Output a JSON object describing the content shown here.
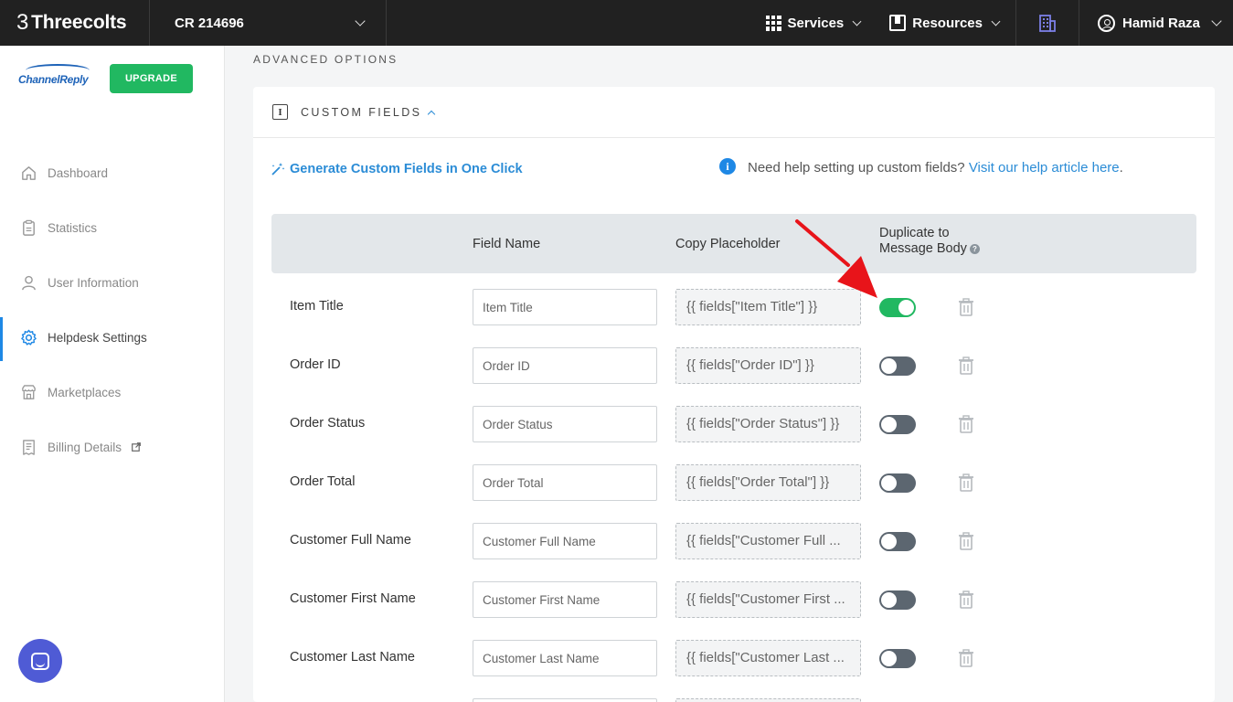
{
  "topbar": {
    "brand": "Threecolts",
    "brand_mark": "3",
    "account": "CR 214696",
    "services": "Services",
    "resources": "Resources",
    "user": "Hamid Raza"
  },
  "sidebar": {
    "logo_text": "ChannelReply",
    "upgrade": "UPGRADE",
    "items": [
      {
        "label": "Dashboard",
        "icon": "home-icon"
      },
      {
        "label": "Statistics",
        "icon": "clipboard-icon"
      },
      {
        "label": "User Information",
        "icon": "user-icon"
      },
      {
        "label": "Helpdesk Settings",
        "icon": "gear-icon"
      },
      {
        "label": "Marketplaces",
        "icon": "store-icon"
      },
      {
        "label": "Billing Details",
        "icon": "receipt-icon"
      }
    ]
  },
  "main": {
    "section_label": "ADVANCED OPTIONS",
    "card_title": "CUSTOM FIELDS",
    "card_icon": "I",
    "generate_link": "Generate Custom Fields in One Click",
    "help_text": "Need help setting up custom fields? ",
    "help_link": "Visit our help article here",
    "help_end": ".",
    "columns": {
      "field_name": "Field Name",
      "copy_placeholder": "Copy Placeholder",
      "duplicate_line1": "Duplicate to",
      "duplicate_line2": "Message Body"
    },
    "rows": [
      {
        "label": "Item Title",
        "value": "Item Title",
        "placeholder": "{{ fields[\"Item Title\"] }}",
        "duplicate": true
      },
      {
        "label": "Order ID",
        "value": "Order ID",
        "placeholder": "{{ fields[\"Order ID\"] }}",
        "duplicate": false
      },
      {
        "label": "Order Status",
        "value": "Order Status",
        "placeholder": "{{ fields[\"Order Status\"] }}",
        "duplicate": false
      },
      {
        "label": "Order Total",
        "value": "Order Total",
        "placeholder": "{{ fields[\"Order Total\"] }}",
        "duplicate": false
      },
      {
        "label": "Customer Full Name",
        "value": "Customer Full Name",
        "placeholder": "{{ fields[\"Customer Full ...",
        "duplicate": false
      },
      {
        "label": "Customer First Name",
        "value": "Customer First Name",
        "placeholder": "{{ fields[\"Customer First ...",
        "duplicate": false
      },
      {
        "label": "Customer Last Name",
        "value": "Customer Last Name",
        "placeholder": "{{ fields[\"Customer Last ...",
        "duplicate": false
      }
    ]
  },
  "colors": {
    "accent_green": "#21b861",
    "link_blue": "#2b8cd6",
    "arrow_red": "#e8141a"
  }
}
